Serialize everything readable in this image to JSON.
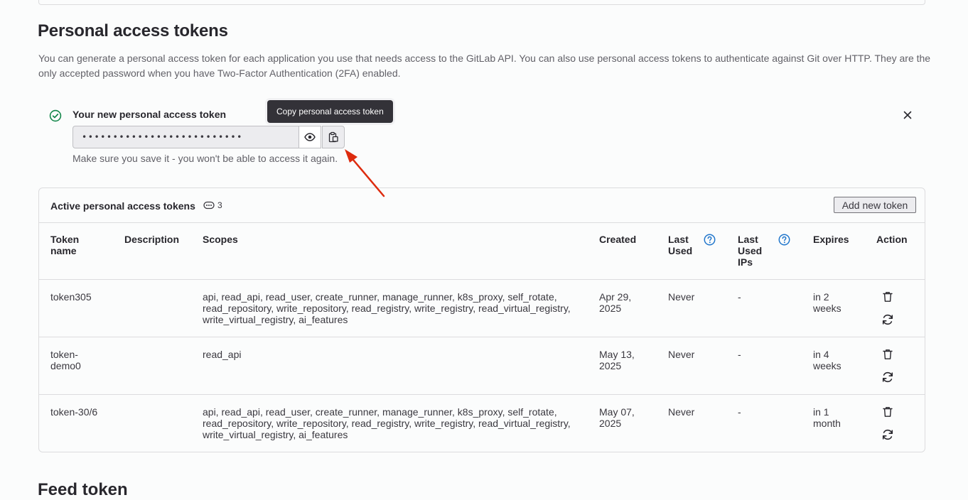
{
  "page": {
    "title": "Personal access tokens",
    "intro": "You can generate a personal access token for each application you use that needs access to the GitLab API. You can also use personal access tokens to authenticate against Git over HTTP. They are the only accepted password when you have Two-Factor Authentication (2FA) enabled."
  },
  "new_token": {
    "title": "Your new personal access token",
    "masked_value": "••••••••••••••••••••••••••",
    "help": "Make sure you save it - you won't be able to access it again.",
    "tooltip": "Copy personal access token",
    "icons": {
      "status": "check-circle-icon",
      "reveal": "eye-icon",
      "copy": "clipboard-icon",
      "close": "close-icon"
    }
  },
  "active_tokens": {
    "title": "Active personal access tokens",
    "count": "3",
    "add_button": "Add new token",
    "columns": {
      "name": "Token name",
      "description": "Description",
      "scopes": "Scopes",
      "created": "Created",
      "last_used": "Last Used",
      "last_used_ips": "Last Used IPs",
      "expires": "Expires",
      "action": "Action"
    },
    "rows": [
      {
        "name": "token305",
        "description": "",
        "scopes": "api, read_api, read_user, create_runner, manage_runner, k8s_proxy, self_rotate, read_repository, write_repository, read_registry, write_registry, read_virtual_registry, write_virtual_registry, ai_features",
        "created": "Apr 29, 2025",
        "last_used": "Never",
        "last_used_ips": "-",
        "expires": "in 2 weeks"
      },
      {
        "name": "token-demo0",
        "description": "",
        "scopes": "read_api",
        "created": "May 13, 2025",
        "last_used": "Never",
        "last_used_ips": "-",
        "expires": "in 4 weeks"
      },
      {
        "name": "token-30/6",
        "description": "",
        "scopes": "api, read_api, read_user, create_runner, manage_runner, k8s_proxy, self_rotate, read_repository, write_repository, read_registry, write_registry, read_virtual_registry, write_virtual_registry, ai_features",
        "created": "May 07, 2025",
        "last_used": "Never",
        "last_used_ips": "-",
        "expires": "in 1 month"
      }
    ],
    "icons": {
      "count": "token-icon",
      "help": "question-circle-icon",
      "delete": "trash-icon",
      "rotate": "retry-icon"
    }
  },
  "feed_token": {
    "title": "Feed token"
  },
  "colors": {
    "success": "#108548",
    "info": "#1f75cb",
    "annotation_arrow": "#dd2b0e",
    "tooltip_bg": "#333238"
  }
}
